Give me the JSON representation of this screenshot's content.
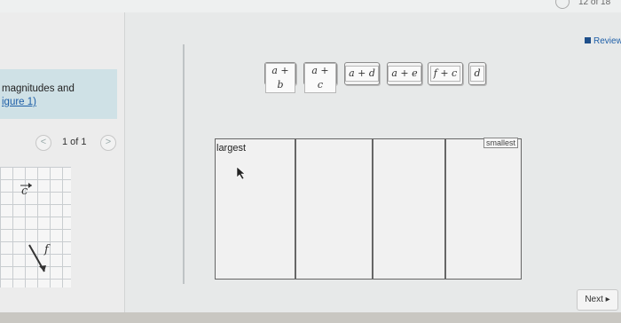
{
  "header": {
    "page_counter": "12 of 18"
  },
  "review": {
    "label": "Review"
  },
  "prompt": {
    "line1": "magnitudes and",
    "link": "igure 1)"
  },
  "pager": {
    "prev": "<",
    "text": "1 of 1",
    "next": ">"
  },
  "figure": {
    "vector_c": "c",
    "vector_f": "f"
  },
  "tiles": [
    "a + b",
    "a + c",
    "a + d",
    "a + e",
    "f + c",
    "d"
  ],
  "bins": {
    "largest": "largest",
    "smallest": "smallest"
  },
  "footer": {
    "next": "Next"
  }
}
